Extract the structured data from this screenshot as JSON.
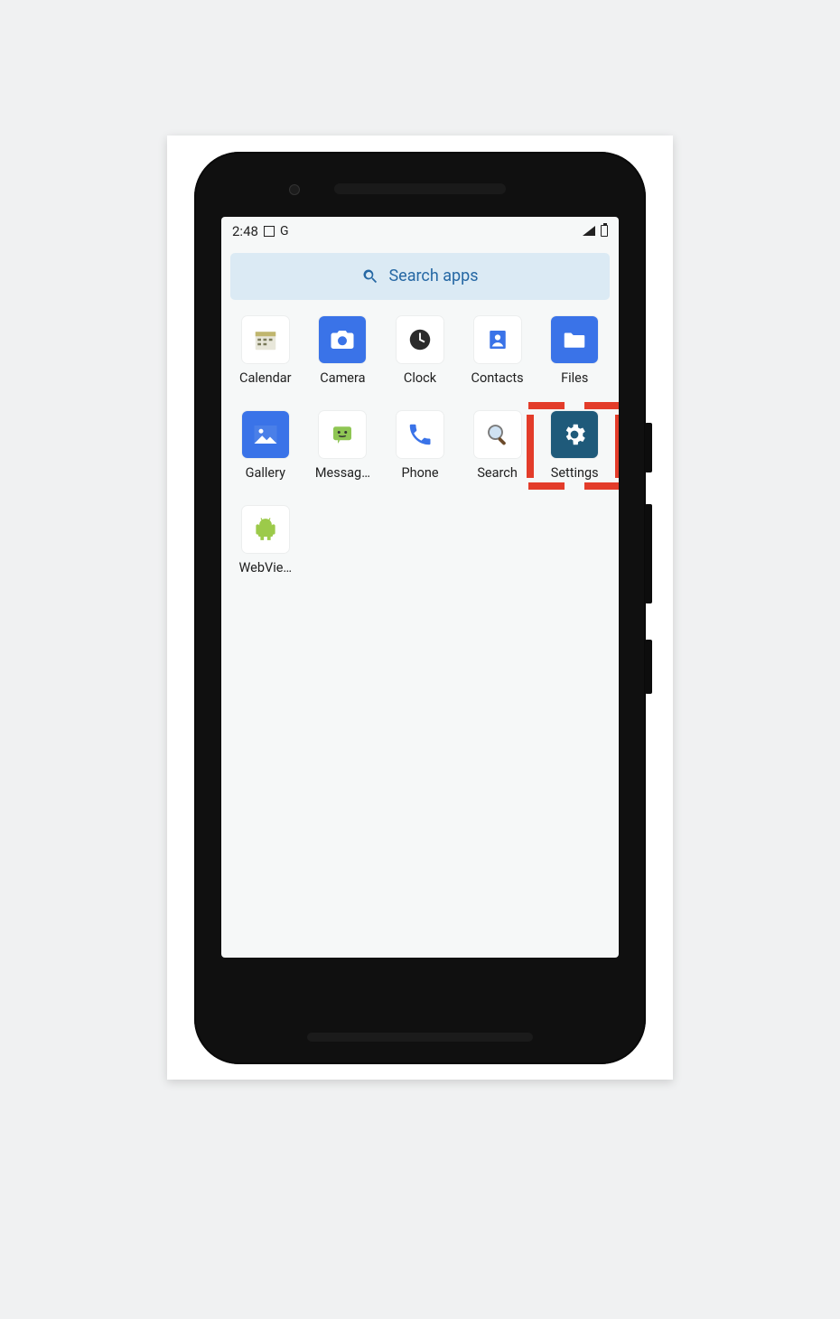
{
  "status": {
    "time": "2:48",
    "left_icons": [
      "square-icon",
      "g-icon"
    ],
    "right_icons": [
      "signal-icon",
      "battery-icon"
    ]
  },
  "search": {
    "placeholder": "Search apps"
  },
  "apps": [
    {
      "label": "Calendar",
      "icon": "calendar-icon"
    },
    {
      "label": "Camera",
      "icon": "camera-icon"
    },
    {
      "label": "Clock",
      "icon": "clock-icon"
    },
    {
      "label": "Contacts",
      "icon": "contacts-icon"
    },
    {
      "label": "Files",
      "icon": "folder-icon"
    },
    {
      "label": "Gallery",
      "icon": "gallery-icon"
    },
    {
      "label": "Messaging",
      "icon": "messaging-icon",
      "display_label": "Messag…"
    },
    {
      "label": "Phone",
      "icon": "phone-icon"
    },
    {
      "label": "Search",
      "icon": "search-icon"
    },
    {
      "label": "Settings",
      "icon": "settings-icon",
      "highlighted": true
    },
    {
      "label": "WebView",
      "icon": "android-icon",
      "display_label": "WebVie…"
    }
  ],
  "annotation": {
    "highlight_color": "#e33c2a",
    "accent_color": "#2668a4"
  }
}
